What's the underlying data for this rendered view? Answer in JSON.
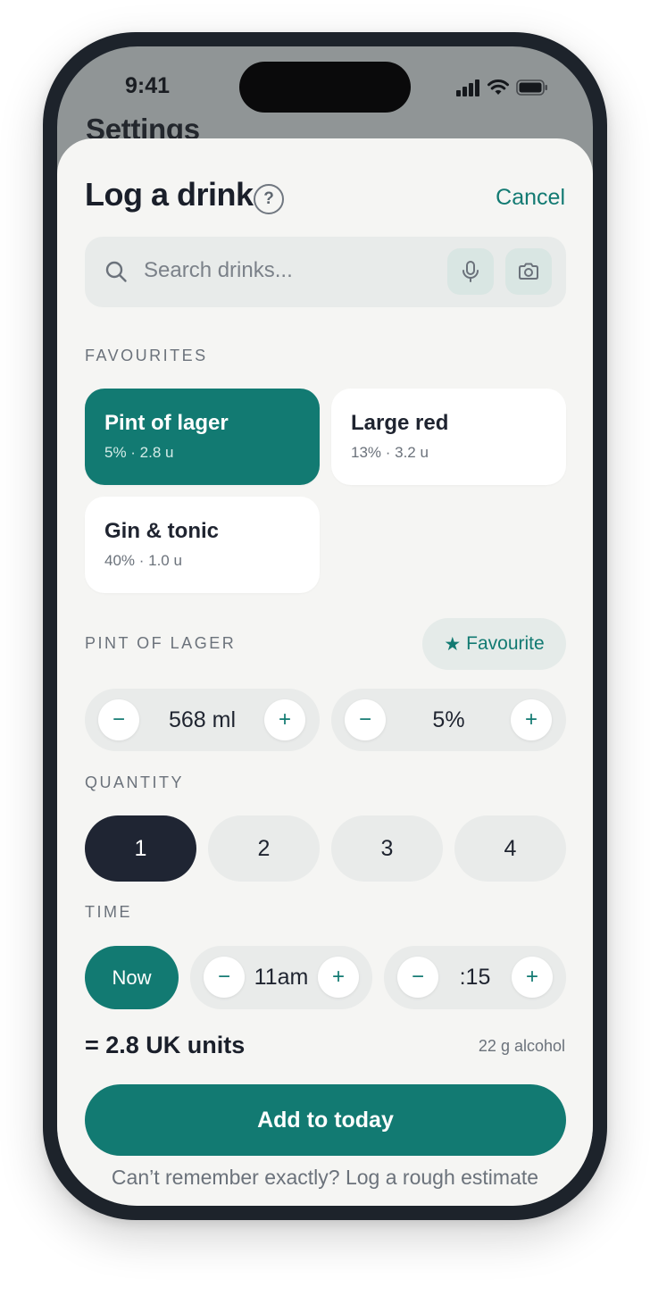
{
  "status_bar": {
    "time": "9:41"
  },
  "background_page": {
    "title": "Settings"
  },
  "sheet": {
    "title": "Log a drink",
    "help_label": "?",
    "cancel_label": "Cancel"
  },
  "search": {
    "placeholder": "Search drinks..."
  },
  "favourites": {
    "label": "FAVOURITES",
    "items": [
      {
        "name": "Pint of lager",
        "meta": "5% · 2.8 u",
        "selected": true
      },
      {
        "name": "Large red",
        "meta": "13% · 3.2 u",
        "selected": false
      },
      {
        "name": "Gin & tonic",
        "meta": "40% · 1.0 u",
        "selected": false
      }
    ]
  },
  "drink_detail": {
    "label": "PINT OF LAGER",
    "favourite_label": "Favourite",
    "volume": {
      "value": "568 ml",
      "minus": "−",
      "plus": "+"
    },
    "abv": {
      "value": "5%",
      "minus": "−",
      "plus": "+"
    }
  },
  "quantity": {
    "label": "QUANTITY",
    "options": [
      "1",
      "2",
      "3",
      "4"
    ],
    "selected": "1"
  },
  "time": {
    "label": "TIME",
    "now_label": "Now",
    "hour": {
      "value": "11am",
      "minus": "−",
      "plus": "+"
    },
    "minute": {
      "value": ":15",
      "minus": "−",
      "plus": "+"
    }
  },
  "summary": {
    "units": "= 2.8 UK units",
    "grams": "22 g alcohol"
  },
  "actions": {
    "add_label": "Add to today",
    "rough_estimate": "Can’t remember exactly? Log a rough estimate"
  },
  "colors": {
    "accent": "#127a72",
    "selected_dark": "#1f2533",
    "sheet_bg": "#f5f5f3"
  }
}
